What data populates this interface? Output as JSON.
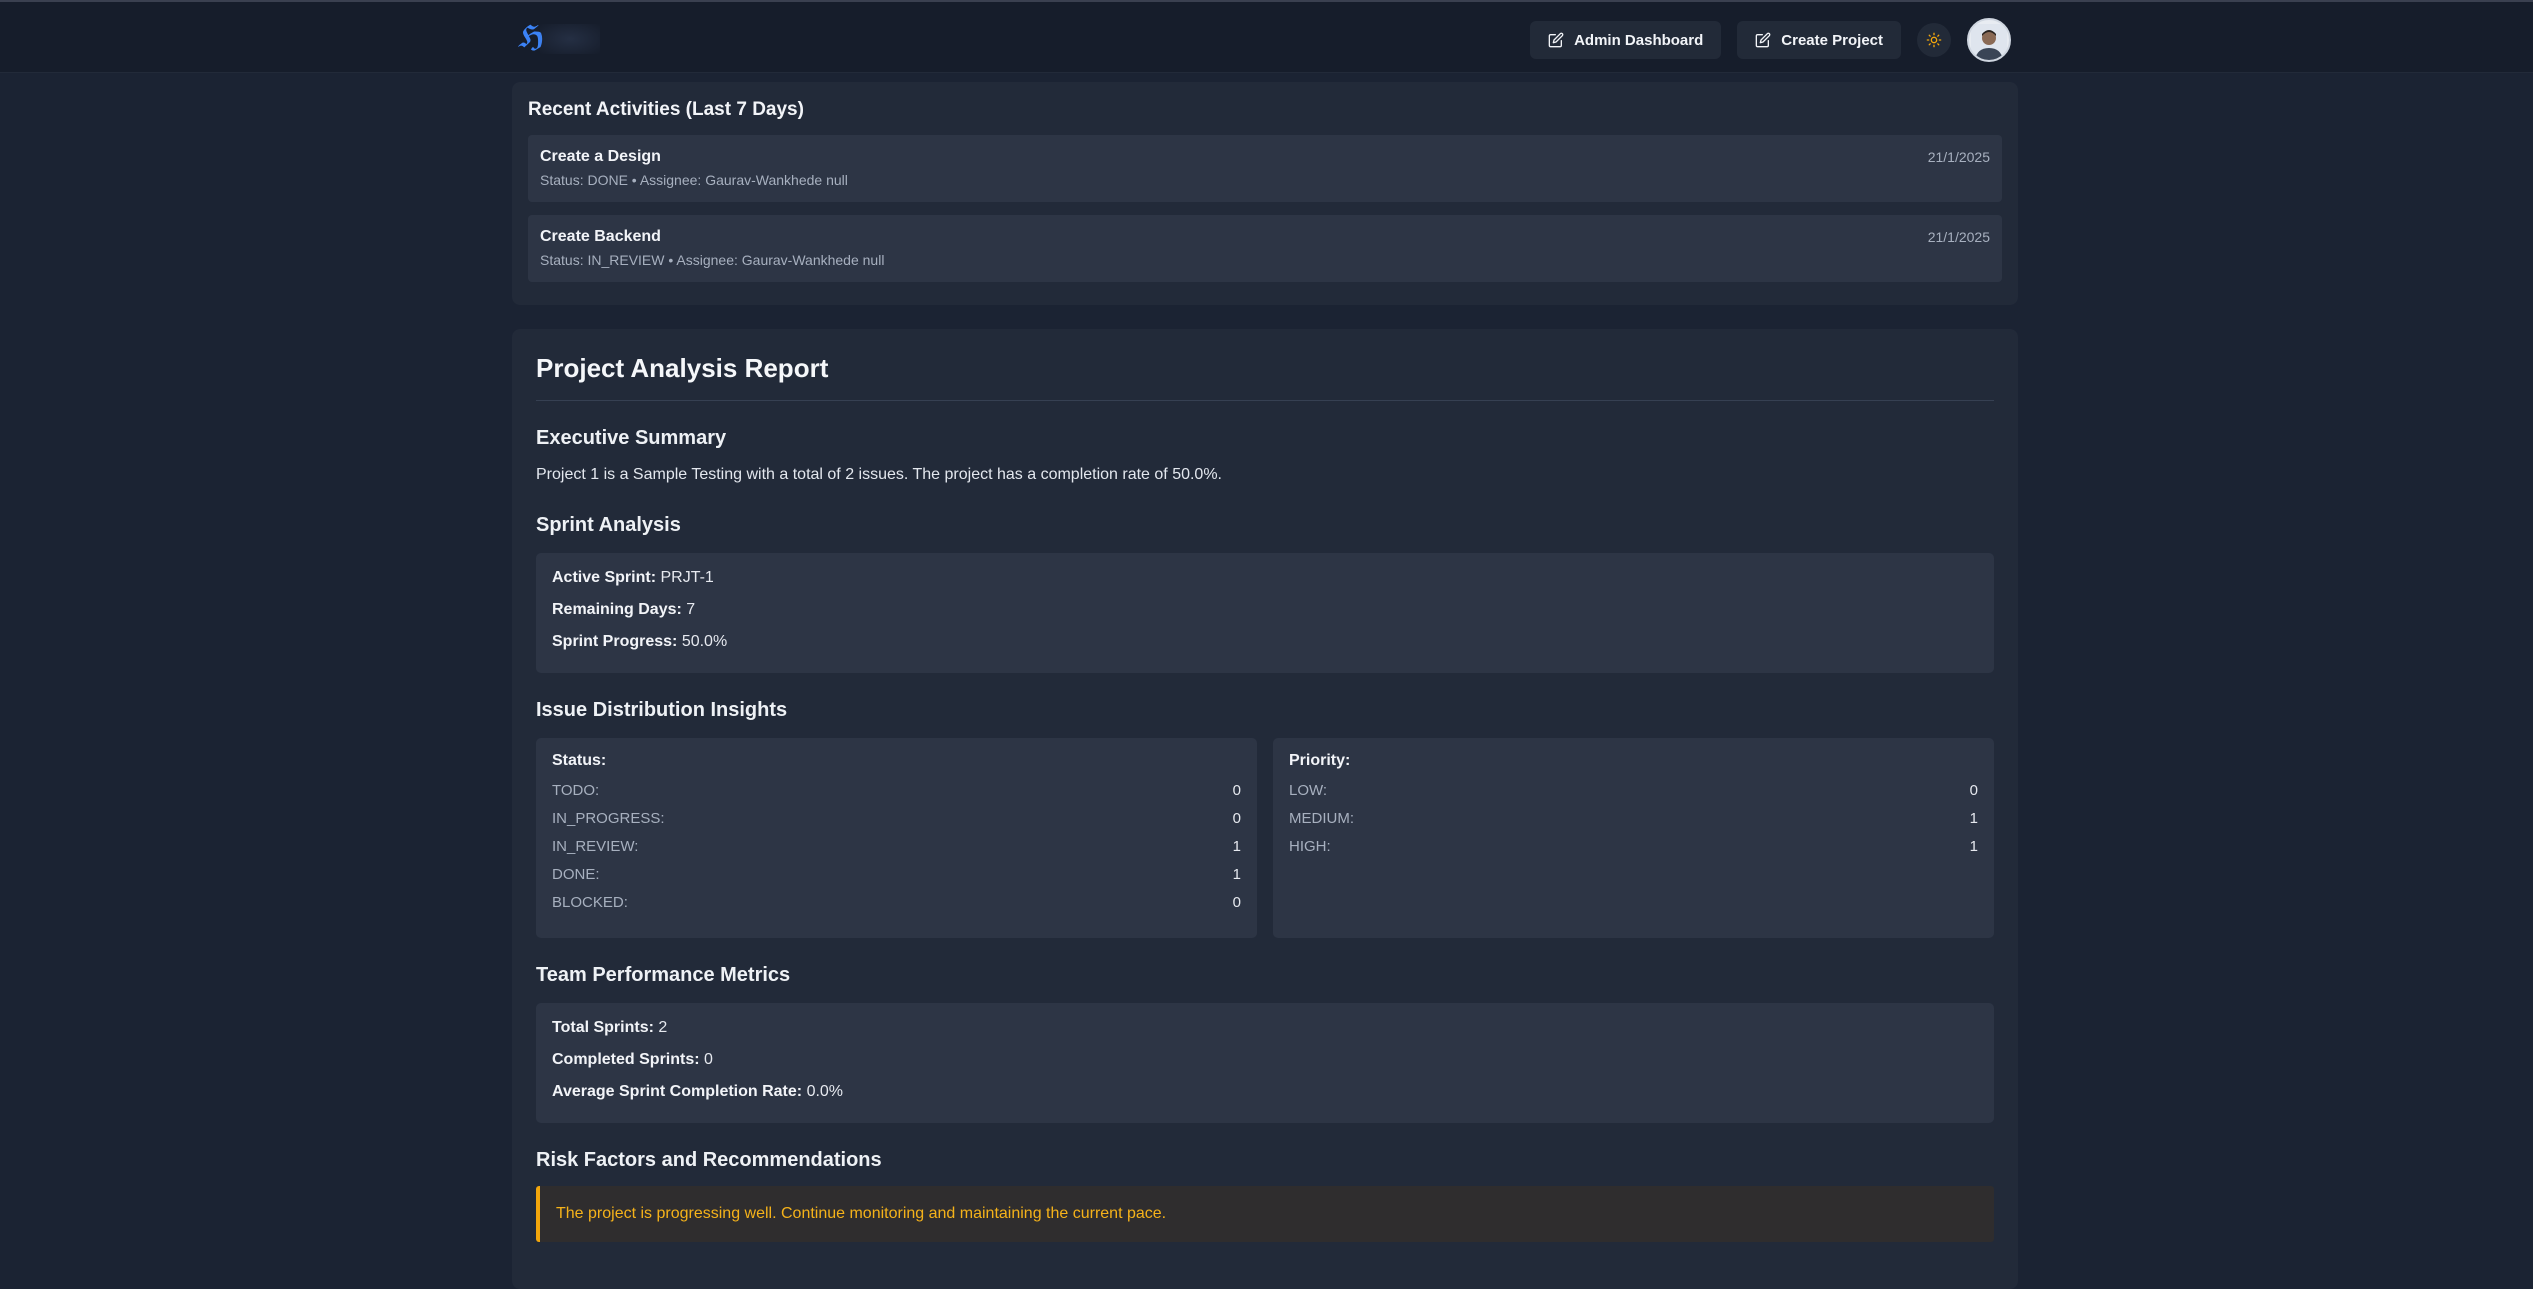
{
  "nav": {
    "logo_glyph": "ℌ",
    "admin_label": "Admin Dashboard",
    "create_label": "Create Project"
  },
  "activities": {
    "title": "Recent Activities (Last 7 Days)",
    "items": [
      {
        "title": "Create a Design",
        "meta": "Status: DONE • Assignee: Gaurav-Wankhede null",
        "date": "21/1/2025"
      },
      {
        "title": "Create Backend",
        "meta": "Status: IN_REVIEW • Assignee: Gaurav-Wankhede null",
        "date": "21/1/2025"
      }
    ]
  },
  "report": {
    "title": "Project Analysis Report",
    "executive": {
      "heading": "Executive Summary",
      "text": "Project 1 is a Sample Testing with a total of 2 issues. The project has a completion rate of 50.0%."
    },
    "sprint": {
      "heading": "Sprint Analysis",
      "active_label": "Active Sprint:",
      "active_value": "PRJT-1",
      "remaining_label": "Remaining Days:",
      "remaining_value": "7",
      "progress_label": "Sprint Progress:",
      "progress_value": "50.0%"
    },
    "distribution": {
      "heading": "Issue Distribution Insights",
      "status_heading": "Status:",
      "status": [
        {
          "k": "TODO:",
          "v": "0"
        },
        {
          "k": "IN_PROGRESS:",
          "v": "0"
        },
        {
          "k": "IN_REVIEW:",
          "v": "1"
        },
        {
          "k": "DONE:",
          "v": "1"
        },
        {
          "k": "BLOCKED:",
          "v": "0"
        }
      ],
      "priority_heading": "Priority:",
      "priority": [
        {
          "k": "LOW:",
          "v": "0"
        },
        {
          "k": "MEDIUM:",
          "v": "1"
        },
        {
          "k": "HIGH:",
          "v": "1"
        }
      ]
    },
    "team": {
      "heading": "Team Performance Metrics",
      "total_label": "Total Sprints:",
      "total_value": "2",
      "completed_label": "Completed Sprints:",
      "completed_value": "0",
      "avg_label": "Average Sprint Completion Rate:",
      "avg_value": "0.0%"
    },
    "risk": {
      "heading": "Risk Factors and Recommendations",
      "text": "The project is progressing well. Continue monitoring and maintaining the current pace."
    }
  },
  "colors": {
    "background": "#1b2333",
    "panel": "#222a39",
    "card": "#2d3545",
    "accent_blue": "#3b82f6",
    "warning": "#f2a60c"
  }
}
